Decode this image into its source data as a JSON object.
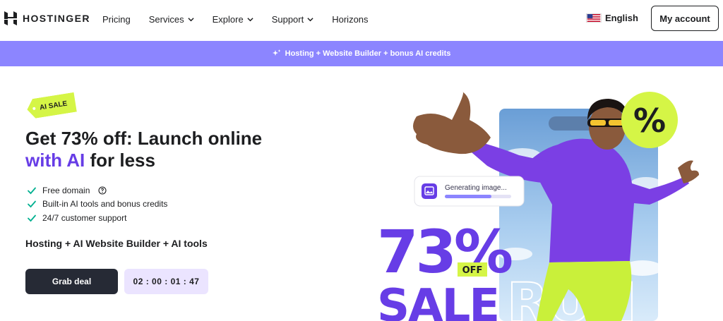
{
  "nav": {
    "brand": "HOSTINGER",
    "items": [
      {
        "label": "Pricing",
        "dropdown": false
      },
      {
        "label": "Services",
        "dropdown": true
      },
      {
        "label": "Explore",
        "dropdown": true
      },
      {
        "label": "Support",
        "dropdown": true
      },
      {
        "label": "Horizons",
        "dropdown": false
      }
    ],
    "language": "English",
    "account_label": "My account"
  },
  "promo": {
    "text": "Hosting + Website Builder + bonus AI credits"
  },
  "hero": {
    "badge": "AI SALE",
    "headline_line1": "Get 73% off: Launch online",
    "headline_accent": "with AI",
    "headline_rest": " for less",
    "features": [
      "Free domain",
      "Built-in AI tools and bonus credits",
      "24/7 customer support"
    ],
    "subheading": "Hosting + AI Website Builder + AI tools",
    "cta_label": "Grab deal",
    "countdown": "02 : 00 : 01 : 47"
  },
  "art": {
    "generating_text": "Generating image...",
    "percent_sign": "%",
    "big_number": "73%",
    "off_label": "OFF",
    "sale_label": "SALE",
    "run_label": "RUN"
  },
  "colors": {
    "accent": "#673de6",
    "promo_bar": "#8c85ff",
    "lime": "#d5f546",
    "button_dark": "#262a35",
    "timer_bg": "#ebe4ff"
  }
}
